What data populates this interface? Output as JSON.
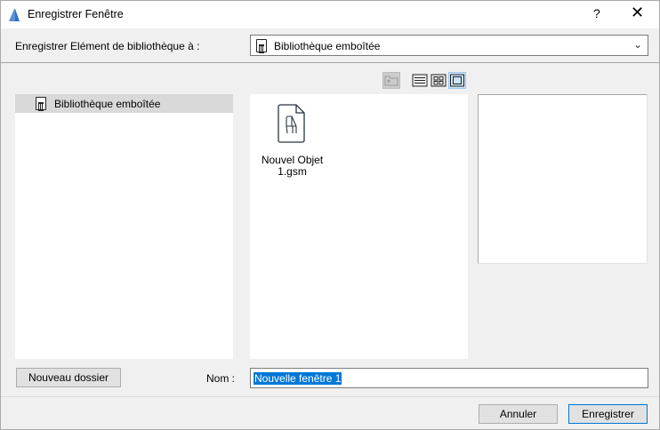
{
  "window": {
    "title": "Enregistrer Fenêtre",
    "help": "?",
    "close": "✕"
  },
  "save_to": {
    "label": "Enregistrer Elément de bibliothèque à :",
    "selected": "Bibliothèque emboîtée"
  },
  "tree": {
    "items": [
      {
        "label": "Bibliothèque emboîtée",
        "selected": true
      }
    ]
  },
  "files": [
    {
      "name": "Nouvel Objet 1.gsm"
    }
  ],
  "toolbar": {
    "icons": [
      "folder-up-icon",
      "list-view-icon",
      "grid-view-icon",
      "large-view-icon"
    ]
  },
  "bottom": {
    "new_folder": "Nouveau dossier",
    "name_label": "Nom :",
    "name_value": "Nouvelle fenêtre 1"
  },
  "footer": {
    "cancel": "Annuler",
    "save": "Enregistrer"
  },
  "colors": {
    "accent": "#0078d7"
  }
}
